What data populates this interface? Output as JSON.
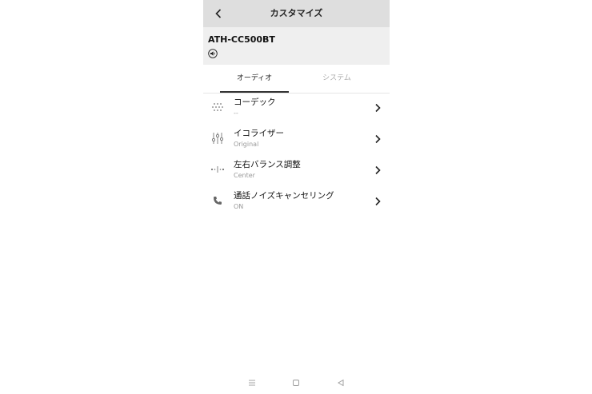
{
  "header": {
    "title": "カスタマイズ",
    "back_icon": "chevron-left-icon"
  },
  "device": {
    "name": "ATH-CC500BT",
    "icon": "speaker-icon"
  },
  "tabs": [
    {
      "label": "オーディオ",
      "active": true
    },
    {
      "label": "システム",
      "active": false
    }
  ],
  "settings": [
    {
      "label": "コーデック",
      "value": "--",
      "icon": "codec-dots-icon"
    },
    {
      "label": "イコライザー",
      "value": "Original",
      "icon": "equalizer-sliders-icon"
    },
    {
      "label": "左右バランス調整",
      "value": "Center",
      "icon": "balance-icon"
    },
    {
      "label": "通話ノイズキャンセリング",
      "value": "ON",
      "icon": "phone-icon"
    }
  ],
  "navbar": {
    "icons": [
      "menu-icon",
      "home-square-icon",
      "back-triangle-icon"
    ]
  },
  "colors": {
    "header_bg": "#dedede",
    "device_bg": "#efefef",
    "text": "#111111",
    "muted": "#999999"
  }
}
